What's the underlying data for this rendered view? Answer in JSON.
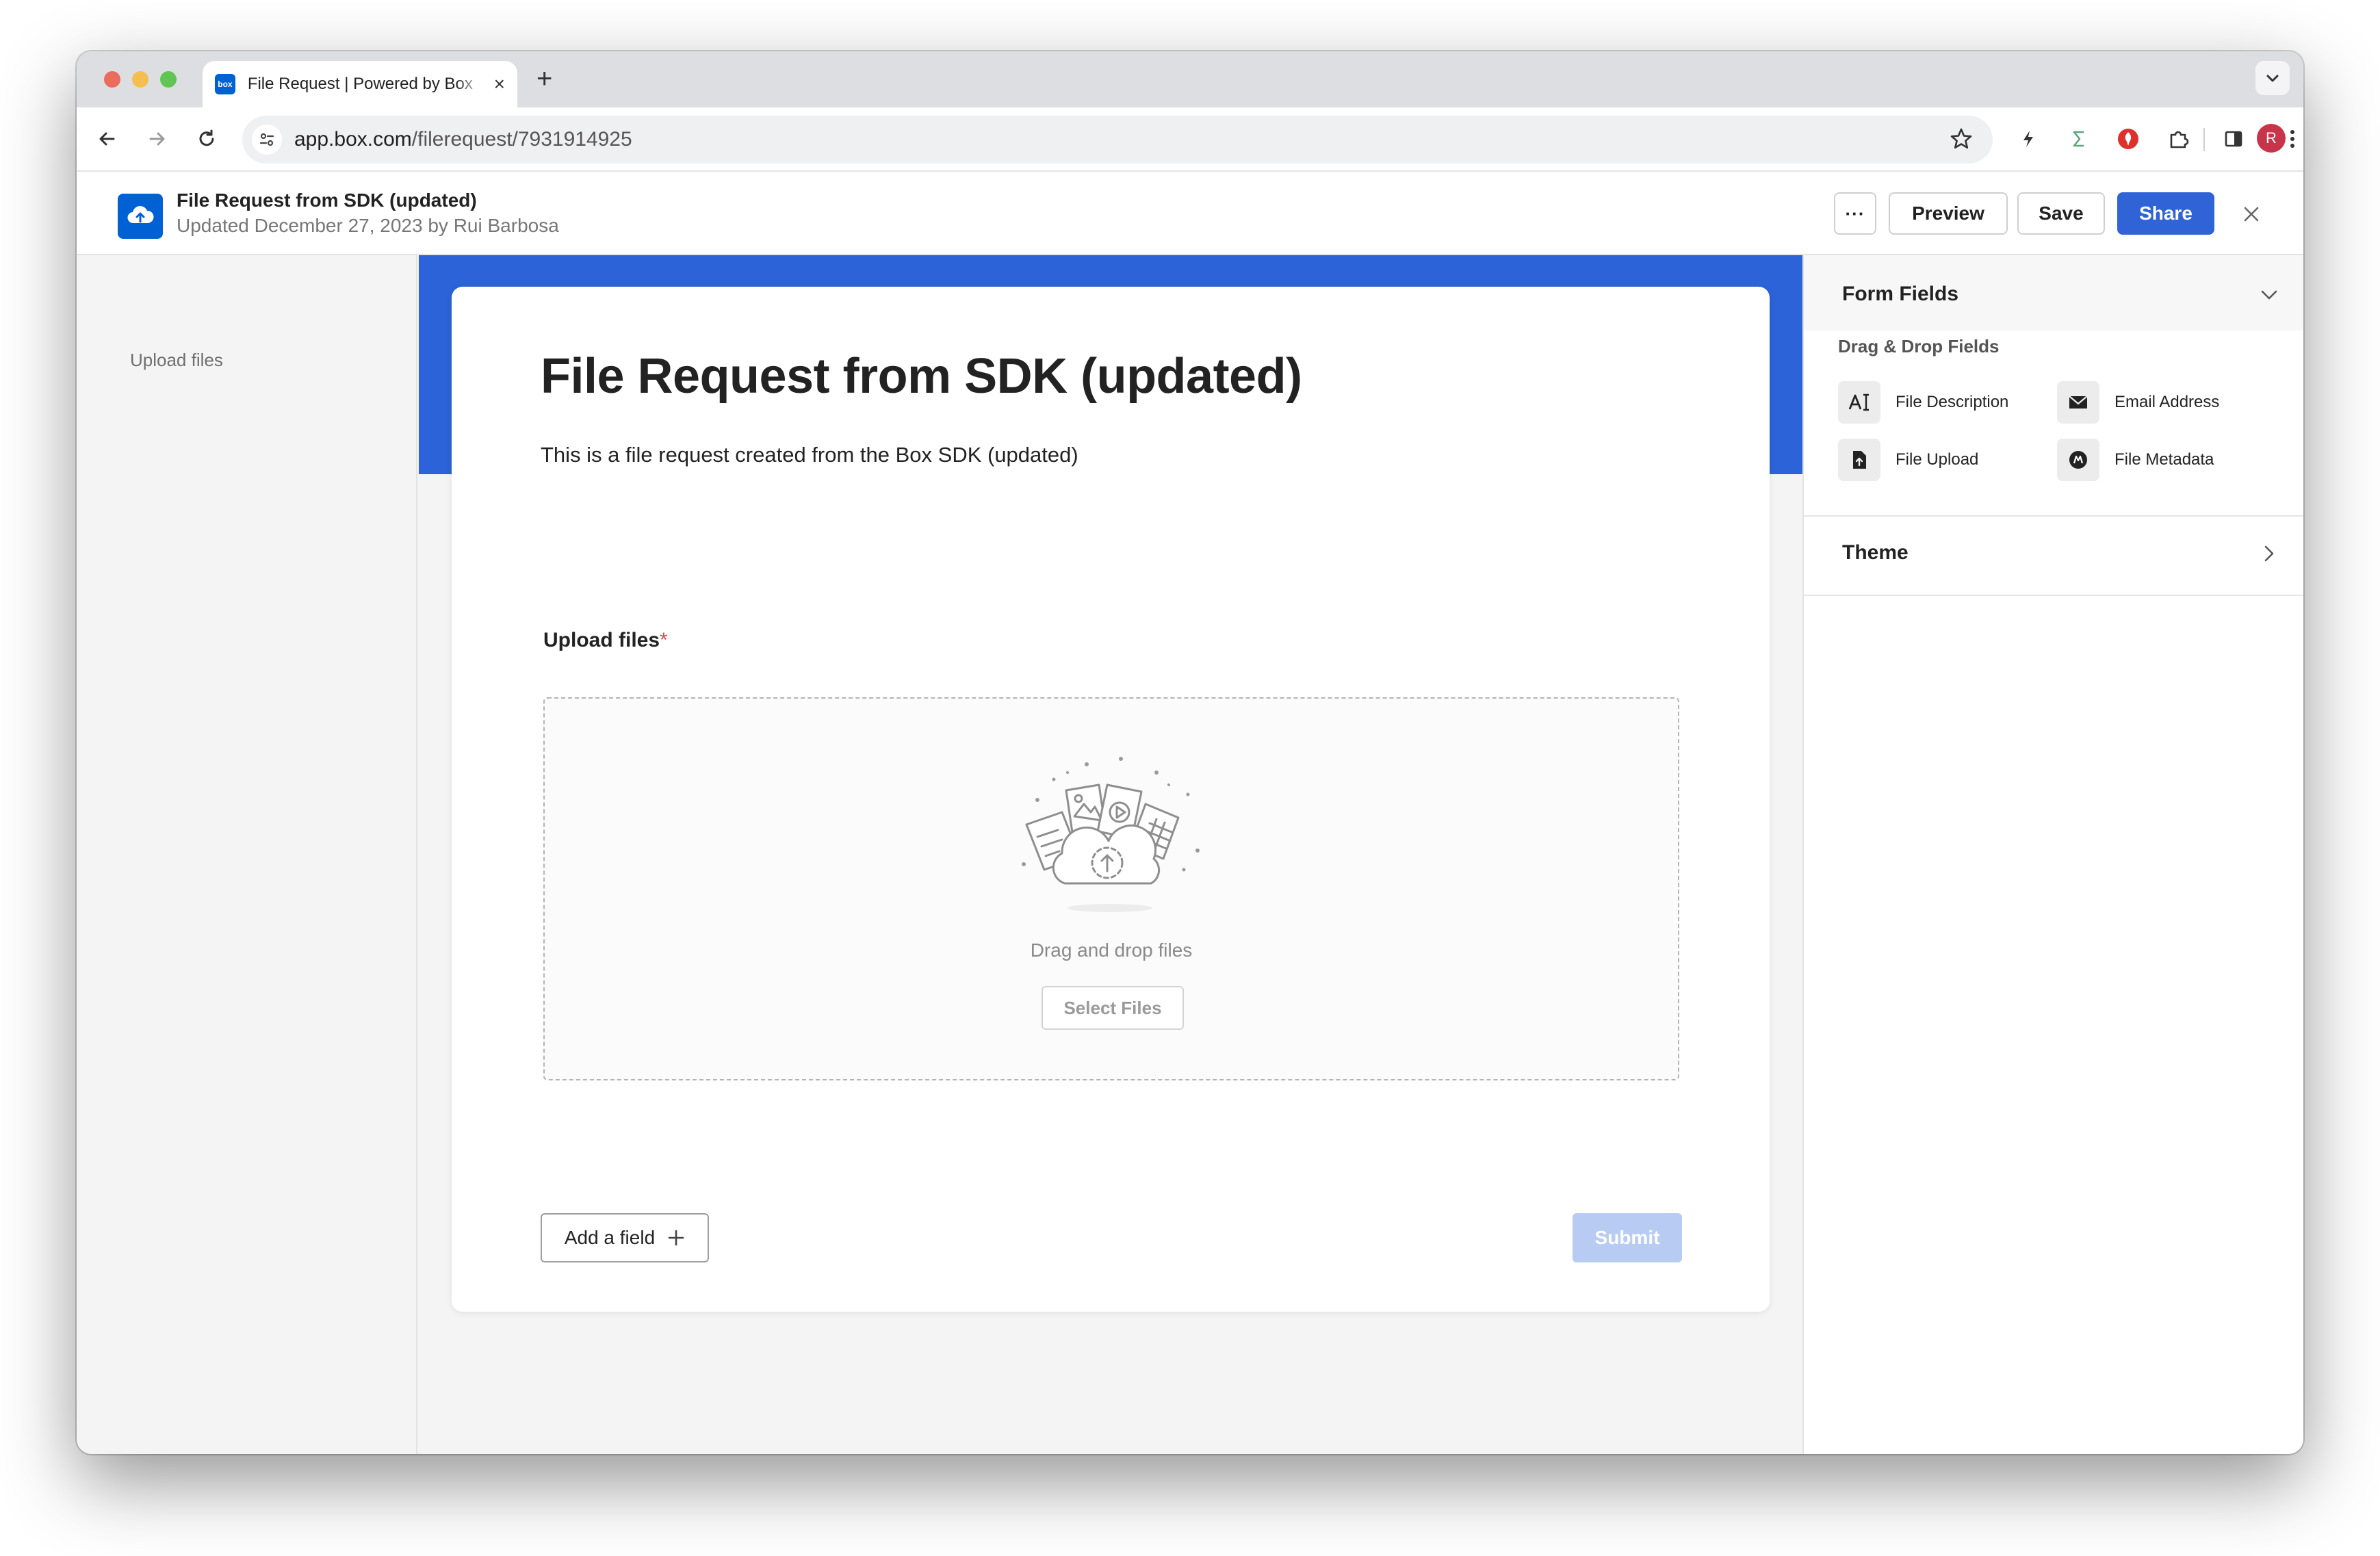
{
  "browser": {
    "tab_title": "File Request | Powered by Box",
    "favicon_text": "box",
    "url_host": "app.box.com",
    "url_path": "/filerequest/7931914925",
    "profile_initial": "R",
    "traffic_lights": [
      "#ec6a5e",
      "#f4bf4f",
      "#61c554"
    ]
  },
  "header": {
    "title": "File Request from SDK (updated)",
    "subtitle": "Updated December 27, 2023 by Rui Barbosa",
    "more_label": "···",
    "preview_label": "Preview",
    "save_label": "Save",
    "share_label": "Share",
    "accent": "#2f63d6"
  },
  "sidebar": {
    "items": [
      {
        "label": "Upload files"
      }
    ]
  },
  "form": {
    "title": "File Request from SDK (updated)",
    "description": "This is a file request created from the Box SDK (updated)",
    "upload_label": "Upload files",
    "required_mark": "*",
    "drop_text": "Drag and drop files",
    "select_files_label": "Select Files",
    "add_field_label": "Add a field",
    "submit_label": "Submit",
    "banner_color": "#2c63d8"
  },
  "panel": {
    "form_fields_title": "Form Fields",
    "drag_drop_label": "Drag & Drop Fields",
    "fields": [
      {
        "label": "File Description",
        "icon": "text-field-icon"
      },
      {
        "label": "Email Address",
        "icon": "envelope-icon"
      },
      {
        "label": "File Upload",
        "icon": "file-upload-icon"
      },
      {
        "label": "File Metadata",
        "icon": "metadata-icon"
      }
    ],
    "theme_title": "Theme"
  }
}
